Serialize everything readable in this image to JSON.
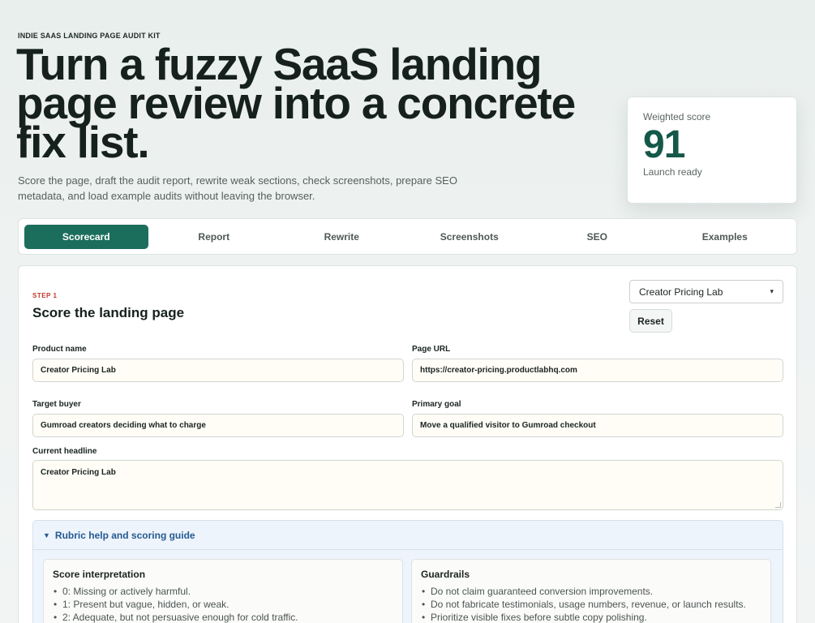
{
  "hero": {
    "eyebrow": "INDIE SAAS LANDING PAGE AUDIT KIT",
    "title": "Turn a fuzzy SaaS landing page review into a concrete fix list.",
    "subtitle": "Score the page, draft the audit report, rewrite weak sections, check screenshots, prepare SEO metadata, and load example audits without leaving the browser."
  },
  "score_card": {
    "label": "Weighted score",
    "value": "91",
    "status": "Launch ready"
  },
  "tabs": [
    {
      "label": "Scorecard",
      "active": true
    },
    {
      "label": "Report",
      "active": false
    },
    {
      "label": "Rewrite",
      "active": false
    },
    {
      "label": "Screenshots",
      "active": false
    },
    {
      "label": "SEO",
      "active": false
    },
    {
      "label": "Examples",
      "active": false
    }
  ],
  "panel": {
    "step": "STEP 1",
    "title": "Score the landing page",
    "example_select": "Creator Pricing Lab",
    "reset_label": "Reset",
    "fields": {
      "product_name": {
        "label": "Product name",
        "value": "Creator Pricing Lab"
      },
      "page_url": {
        "label": "Page URL",
        "value": "https://creator-pricing.productlabhq.com"
      },
      "target_buyer": {
        "label": "Target buyer",
        "value": "Gumroad creators deciding what to charge"
      },
      "primary_goal": {
        "label": "Primary goal",
        "value": "Move a qualified visitor to Gumroad checkout"
      },
      "current_headline": {
        "label": "Current headline",
        "value": "Creator Pricing Lab"
      }
    },
    "rubric": {
      "summary": "Rubric help and scoring guide",
      "interpretation": {
        "title": "Score interpretation",
        "items": [
          "0: Missing or actively harmful.",
          "1: Present but vague, hidden, or weak.",
          "2: Adequate, but not persuasive enough for cold traffic."
        ]
      },
      "guardrails": {
        "title": "Guardrails",
        "items": [
          "Do not claim guaranteed conversion improvements.",
          "Do not fabricate testimonials, usage numbers, revenue, or launch results.",
          "Prioritize visible fixes before subtle copy polishing."
        ]
      }
    }
  }
}
